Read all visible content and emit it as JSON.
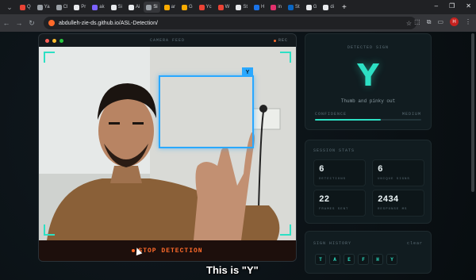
{
  "browser": {
    "tabs": [
      {
        "label": "Q",
        "color": "#ea4335"
      },
      {
        "label": "Ya",
        "color": "#9aa0a6"
      },
      {
        "label": "Cl",
        "color": "#9aa0a6"
      },
      {
        "label": "Pr",
        "color": "#e8eaed"
      },
      {
        "label": "ak",
        "color": "#7b61ff"
      },
      {
        "label": "Si",
        "color": "#e8eaed"
      },
      {
        "label": "Ai",
        "color": "#e8eaed"
      },
      {
        "label": "Si",
        "color": "#9aa0a6"
      },
      {
        "label": "ar",
        "color": "#f9ab00"
      },
      {
        "label": "G",
        "color": "#f9ab00"
      },
      {
        "label": "Yc",
        "color": "#ea4335"
      },
      {
        "label": "W",
        "color": "#ea4335"
      },
      {
        "label": "St",
        "color": "#e8eaed"
      },
      {
        "label": "H",
        "color": "#1a73e8"
      },
      {
        "label": "in",
        "color": "#e1306c"
      },
      {
        "label": "St",
        "color": "#0a66c2"
      },
      {
        "label": "G",
        "color": "#e8eaed"
      },
      {
        "label": "di",
        "color": "#e8eaed"
      }
    ],
    "new_tab": "+",
    "url": "abdulleh-zie-ds.github.io/ASL-Detection/",
    "profile_initial": "H"
  },
  "camera": {
    "title": "CAMERA FEED",
    "rec_label": "REC",
    "detected_tag": "Y",
    "stop_label": "STOP DETECTION"
  },
  "sign": {
    "title": "DETECTED SIGN",
    "letter": "Y",
    "description": "Thumb and pinky out",
    "confidence_label": "CONFIDENCE",
    "confidence_level": "MEDIUM",
    "confidence_fraction": 0.62
  },
  "stats": {
    "title": "SESSION STATS",
    "items": [
      {
        "value": "6",
        "label": "DETECTIONS"
      },
      {
        "value": "6",
        "label": "UNIQUE SIGNS"
      },
      {
        "value": "22",
        "label": "FRAMES SENT"
      },
      {
        "value": "2434",
        "label": "RESPONSE MS"
      }
    ]
  },
  "history": {
    "title": "SIGN HISTORY",
    "clear_label": "clear",
    "letters": [
      "T",
      "A",
      "E",
      "F",
      "H",
      "Y"
    ]
  },
  "caption": "This is \"Y\"",
  "colors": {
    "accent": "#2de0c4",
    "alert": "#ff6a2a",
    "box": "#2aa8ff"
  }
}
